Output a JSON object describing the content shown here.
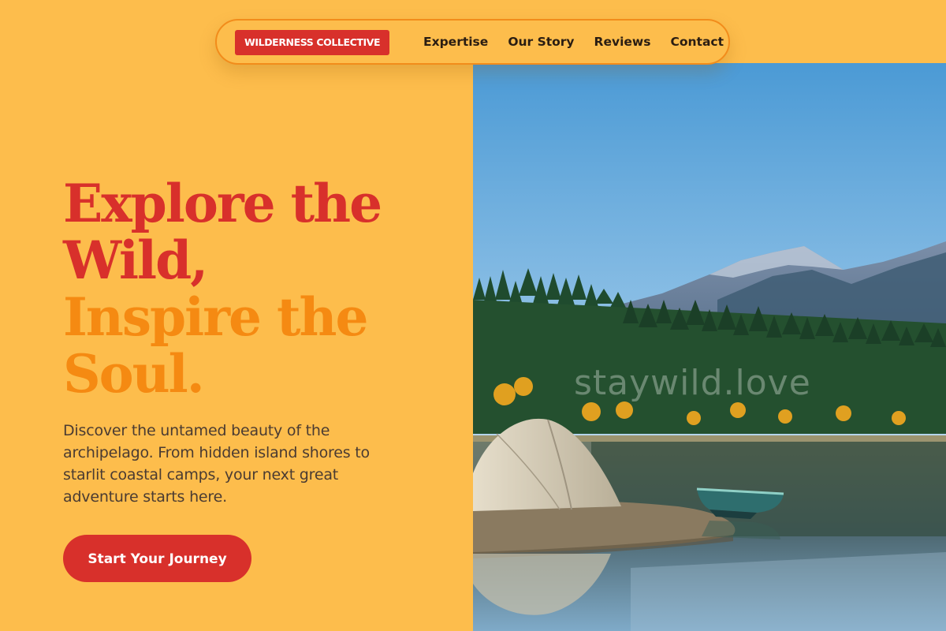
{
  "nav": {
    "brand": "WILDERNESS COLLECTIVE",
    "links": [
      "Expertise",
      "Our Story",
      "Reviews",
      "Contact"
    ]
  },
  "hero": {
    "headline_line1": "Explore the Wild,",
    "headline_line2": "Inspire the Soul.",
    "description": "Discover the untamed beauty of the archipelago. From hidden island shores to starlit coastal camps, your next great adventure starts here.",
    "cta_label": "Start Your Journey"
  },
  "image": {
    "watermark": "staywild.love"
  },
  "colors": {
    "background": "#FDBD4C",
    "brand_red": "#D8302B",
    "accent_orange": "#F58A12",
    "nav_border": "#F28C1B",
    "body_text": "#4a3b32"
  }
}
